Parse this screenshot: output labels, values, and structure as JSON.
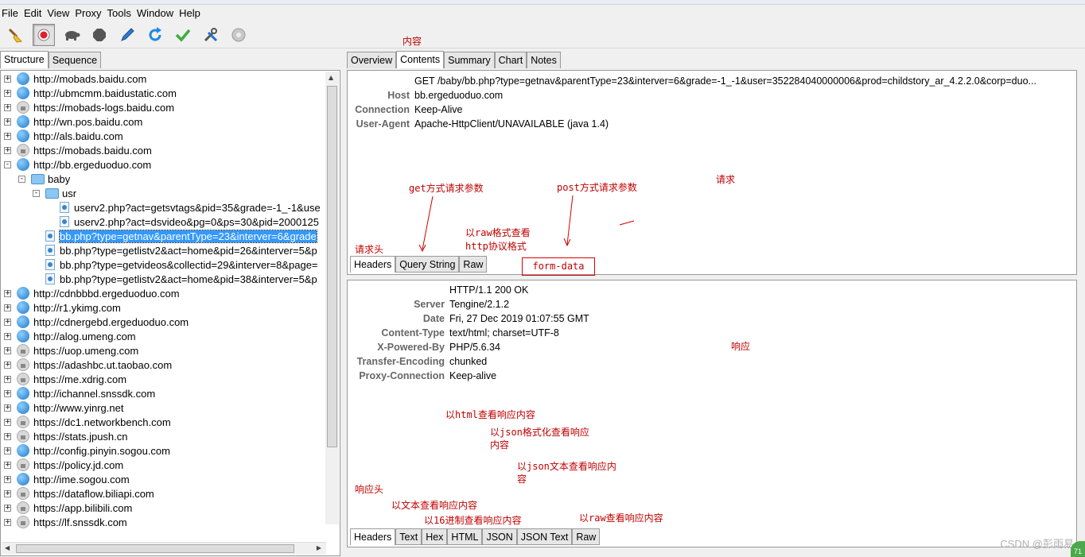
{
  "menu": [
    "File",
    "Edit",
    "View",
    "Proxy",
    "Tools",
    "Window",
    "Help"
  ],
  "toolbar": {
    "icons": [
      "broom-icon",
      "record-icon",
      "turtle-icon",
      "stop-icon",
      "pen-icon",
      "refresh-icon",
      "check-icon",
      "tools-icon",
      "settings-icon"
    ],
    "record_color": "#e11d2a"
  },
  "left_tabs": [
    "Structure",
    "Sequence"
  ],
  "tree": [
    {
      "label": "http://mobads.baidu.com",
      "icon": "globe",
      "level": 0,
      "exp": "+"
    },
    {
      "label": "http://ubmcmm.baidustatic.com",
      "icon": "globe",
      "level": 0,
      "exp": "+"
    },
    {
      "label": "https://mobads-logs.baidu.com",
      "icon": "lock",
      "level": 0,
      "exp": "+"
    },
    {
      "label": "http://wn.pos.baidu.com",
      "icon": "globe",
      "level": 0,
      "exp": "+"
    },
    {
      "label": "http://als.baidu.com",
      "icon": "globe",
      "level": 0,
      "exp": "+"
    },
    {
      "label": "https://mobads.baidu.com",
      "icon": "lock",
      "level": 0,
      "exp": "+"
    },
    {
      "label": "http://bb.ergeduoduo.com",
      "icon": "globe",
      "level": 0,
      "exp": "-"
    },
    {
      "label": "baby",
      "icon": "folder",
      "level": 1,
      "exp": "-"
    },
    {
      "label": "usr",
      "icon": "folder",
      "level": 2,
      "exp": "-"
    },
    {
      "label": "userv2.php?act=getsvtags&pid=35&grade=-1_-1&use",
      "icon": "file",
      "level": 3,
      "exp": ""
    },
    {
      "label": "userv2.php?act=dsvideo&pg=0&ps=30&pid=2000125",
      "icon": "file",
      "level": 3,
      "exp": ""
    },
    {
      "label": "bb.php?type=getnav&parentType=23&interver=6&grade",
      "icon": "file",
      "level": 2,
      "exp": "",
      "selected": true
    },
    {
      "label": "bb.php?type=getlistv2&act=home&pid=26&interver=5&p",
      "icon": "file",
      "level": 2,
      "exp": ""
    },
    {
      "label": "bb.php?type=getvideos&collectid=29&interver=8&page=",
      "icon": "file",
      "level": 2,
      "exp": ""
    },
    {
      "label": "bb.php?type=getlistv2&act=home&pid=38&interver=5&p",
      "icon": "file",
      "level": 2,
      "exp": ""
    },
    {
      "label": "http://cdnbbbd.ergeduoduo.com",
      "icon": "globe",
      "level": 0,
      "exp": "+"
    },
    {
      "label": "http://r1.ykimg.com",
      "icon": "globe",
      "level": 0,
      "exp": "+"
    },
    {
      "label": "http://cdnergebd.ergeduoduo.com",
      "icon": "globe",
      "level": 0,
      "exp": "+"
    },
    {
      "label": "http://alog.umeng.com",
      "icon": "globe",
      "level": 0,
      "exp": "+"
    },
    {
      "label": "https://uop.umeng.com",
      "icon": "lock",
      "level": 0,
      "exp": "+"
    },
    {
      "label": "https://adashbc.ut.taobao.com",
      "icon": "lock",
      "level": 0,
      "exp": "+"
    },
    {
      "label": "https://me.xdrig.com",
      "icon": "lock",
      "level": 0,
      "exp": "+"
    },
    {
      "label": "http://ichannel.snssdk.com",
      "icon": "globe",
      "level": 0,
      "exp": "+"
    },
    {
      "label": "http://www.yinrg.net",
      "icon": "globe",
      "level": 0,
      "exp": "+"
    },
    {
      "label": "https://dc1.networkbench.com",
      "icon": "lock",
      "level": 0,
      "exp": "+"
    },
    {
      "label": "https://stats.jpush.cn",
      "icon": "lock",
      "level": 0,
      "exp": "+"
    },
    {
      "label": "http://config.pinyin.sogou.com",
      "icon": "globe",
      "level": 0,
      "exp": "+"
    },
    {
      "label": "https://policy.jd.com",
      "icon": "lock",
      "level": 0,
      "exp": "+"
    },
    {
      "label": "http://ime.sogou.com",
      "icon": "globe",
      "level": 0,
      "exp": "+"
    },
    {
      "label": "https://dataflow.biliapi.com",
      "icon": "lock",
      "level": 0,
      "exp": "+"
    },
    {
      "label": "https://app.bilibili.com",
      "icon": "lock",
      "level": 0,
      "exp": "+"
    },
    {
      "label": "https://lf.snssdk.com",
      "icon": "lock",
      "level": 0,
      "exp": "+"
    }
  ],
  "right_tabs": [
    "Overview",
    "Contents",
    "Summary",
    "Chart",
    "Notes"
  ],
  "request": {
    "first_line": "GET /baby/bb.php?type=getnav&parentType=23&interver=6&grade=-1_-1&user=352284040000006&prod=childstory_ar_4.2.2.0&corp=duo...",
    "headers": [
      {
        "k": "Host",
        "v": "bb.ergeduoduo.com"
      },
      {
        "k": "Connection",
        "v": "Keep-Alive"
      },
      {
        "k": "User-Agent",
        "v": "Apache-HttpClient/UNAVAILABLE (java 1.4)"
      }
    ],
    "tabs": [
      "Headers",
      "Query String",
      "Raw"
    ]
  },
  "response": {
    "first_line": "HTTP/1.1 200 OK",
    "headers": [
      {
        "k": "Server",
        "v": "Tengine/2.1.2"
      },
      {
        "k": "Date",
        "v": "Fri, 27 Dec 2019 01:07:55 GMT"
      },
      {
        "k": "Content-Type",
        "v": "text/html; charset=UTF-8"
      },
      {
        "k": "X-Powered-By",
        "v": "PHP/5.6.34"
      },
      {
        "k": "Transfer-Encoding",
        "v": "chunked"
      },
      {
        "k": "Proxy-Connection",
        "v": "Keep-alive"
      }
    ],
    "tabs": [
      "Headers",
      "Text",
      "Hex",
      "HTML",
      "JSON",
      "JSON Text",
      "Raw"
    ]
  },
  "annotations": {
    "contents": "内容",
    "get_params": "get方式请求参数",
    "post_params": "post方式请求参数",
    "request": "请求",
    "raw_view_1": "以raw格式查看",
    "raw_view_2": "http协议格式",
    "req_header": "请求头",
    "form_data": "form-data",
    "response": "响应",
    "html_view": "以html查看响应内容",
    "json_fmt_1": "以json格式化查看响应",
    "json_fmt_2": "内容",
    "json_text_1": "以json文本查看响应内",
    "json_text_2": "容",
    "resp_header": "响应头",
    "text_view": "以文本查看响应内容",
    "hex_view": "以16进制查看响应内容",
    "raw_resp": "以raw查看响应内容"
  },
  "watermark": "CSDN @彭雨易",
  "corner_badge": "71"
}
